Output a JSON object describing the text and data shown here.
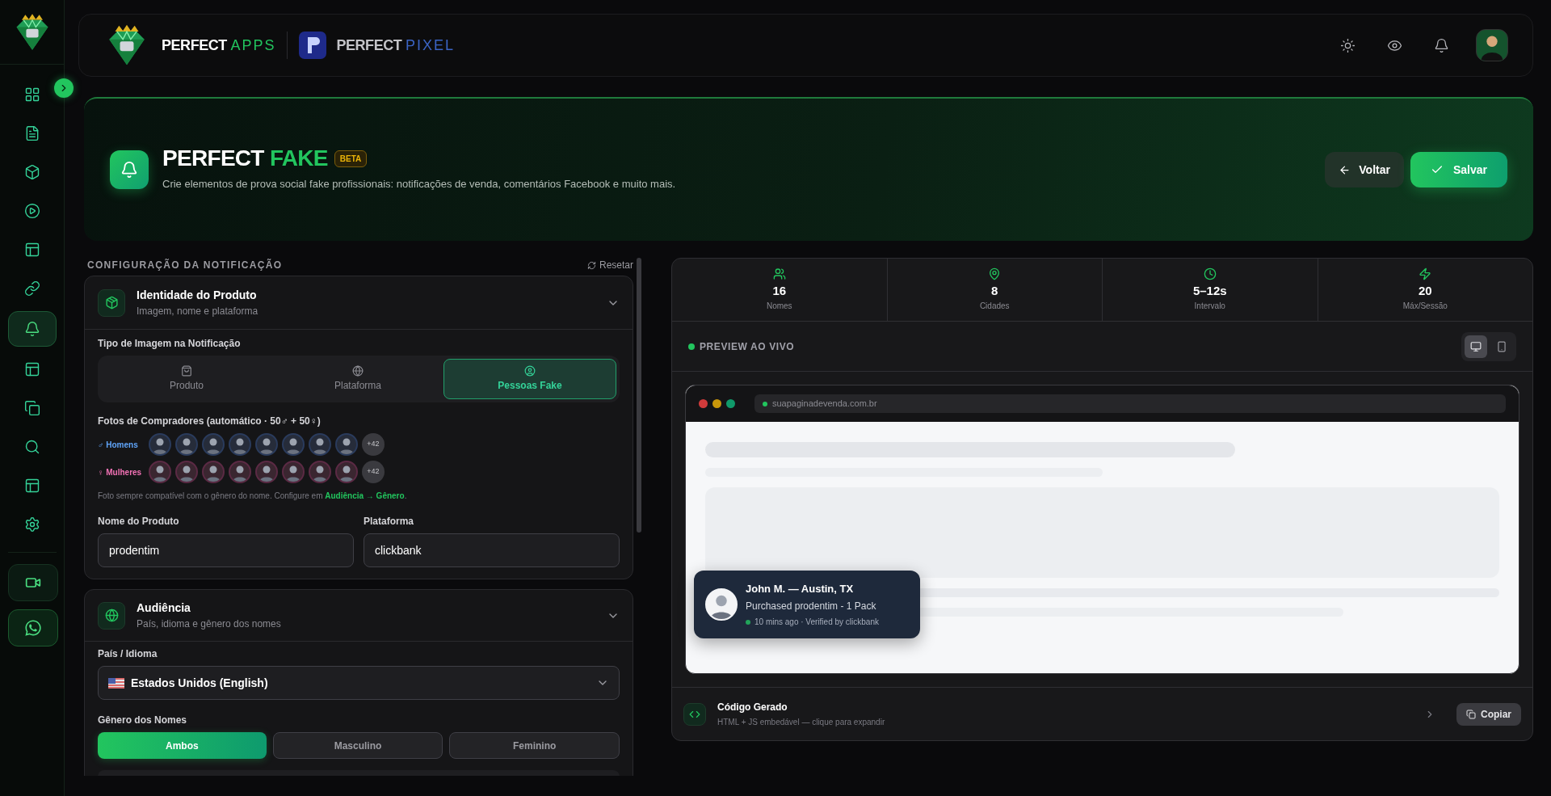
{
  "sidebar": {
    "items": [
      {
        "kind": "grid",
        "selected": false
      },
      {
        "kind": "file",
        "selected": false
      },
      {
        "kind": "box",
        "selected": false
      },
      {
        "kind": "play",
        "selected": false
      },
      {
        "kind": "layout",
        "selected": false
      },
      {
        "kind": "link",
        "selected": false
      },
      {
        "kind": "bell",
        "selected": true
      },
      {
        "kind": "layout",
        "selected": false
      },
      {
        "kind": "copy",
        "selected": false
      },
      {
        "kind": "search",
        "selected": false
      },
      {
        "kind": "layout",
        "selected": false
      },
      {
        "kind": "settings",
        "selected": false
      }
    ],
    "bottom_items": [
      {
        "kind": "video"
      },
      {
        "kind": "whatsapp"
      }
    ]
  },
  "header": {
    "brands": [
      {
        "kind": "apps",
        "word1": "PERFECT",
        "word2": "APPS"
      },
      {
        "kind": "pixel",
        "word1": "PERFECT",
        "word2": "PIXEL"
      }
    ],
    "actions": [
      {
        "kind": "sun"
      },
      {
        "kind": "eye"
      },
      {
        "kind": "bell"
      }
    ]
  },
  "hero": {
    "title_main": "PERFECT",
    "title_accent": "FAKE",
    "badge": "BETA",
    "subtitle": "Crie elementos de prova social fake profissionais: notificações de venda, comentários Facebook e muito mais.",
    "buttons": [
      {
        "kind": "back",
        "label": "Voltar"
      },
      {
        "kind": "save",
        "label": "Salvar"
      }
    ]
  },
  "config": {
    "heading": "CONFIGURAÇÃO DA NOTIFICAÇÃO",
    "reset": "Resetar",
    "product_card": {
      "title": "Identidade do Produto",
      "subtitle": "Imagem, nome e plataforma",
      "image_type_label": "Tipo de Imagem na Notificação",
      "image_types": [
        {
          "kind": "bag",
          "label": "Produto",
          "selected": false
        },
        {
          "kind": "globe",
          "label": "Plataforma",
          "selected": false
        },
        {
          "kind": "user",
          "label": "Pessoas Fake",
          "selected": true
        }
      ],
      "photos_label": "Fotos de Compradores (automático · 50♂ + 50♀)",
      "photo_rows": [
        {
          "kind": "male",
          "label": "♂ Homens",
          "more": "+42"
        },
        {
          "kind": "female",
          "label": "♀ Mulheres",
          "more": "+42"
        }
      ],
      "hint": "Foto sempre compatível com o gênero do nome. Configure em",
      "hint_link": "Audiência → Gênero",
      "hint_end": ".",
      "fields": [
        {
          "label": "Nome do Produto",
          "value": "prodentim"
        },
        {
          "label": "Plataforma",
          "value": "clickbank"
        }
      ]
    },
    "audience_card": {
      "title": "Audiência",
      "subtitle": "País, idioma e gênero dos nomes",
      "country_label": "País / Idioma",
      "country_value": "Estados Unidos (English)",
      "gender_label": "Gênero dos Nomes",
      "genders": [
        {
          "label": "Ambos",
          "selected": true
        },
        {
          "label": "Masculino",
          "selected": false
        },
        {
          "label": "Feminino",
          "selected": false
        }
      ]
    }
  },
  "preview": {
    "stats": [
      {
        "kind": "users",
        "value": "16",
        "label": "Nomes"
      },
      {
        "kind": "pin",
        "value": "8",
        "label": "Cidades"
      },
      {
        "kind": "clock",
        "value": "5–12s",
        "label": "Intervalo"
      },
      {
        "kind": "zap",
        "value": "20",
        "label": "Máx/Sessão"
      }
    ],
    "title": "PREVIEW AO VIVO",
    "devices": [
      {
        "kind": "desktop",
        "selected": true
      },
      {
        "kind": "mobile",
        "selected": false
      }
    ],
    "url": "suapaginadevenda.com.br",
    "toast": {
      "name": "John M. — Austin, TX",
      "action": "Purchased prodentim - 1 Pack",
      "meta": "10 mins ago · Verified by clickbank"
    },
    "code": {
      "title": "Código Gerado",
      "subtitle": "HTML + JS embedável — clique para expandir",
      "copy": "Copiar"
    }
  }
}
